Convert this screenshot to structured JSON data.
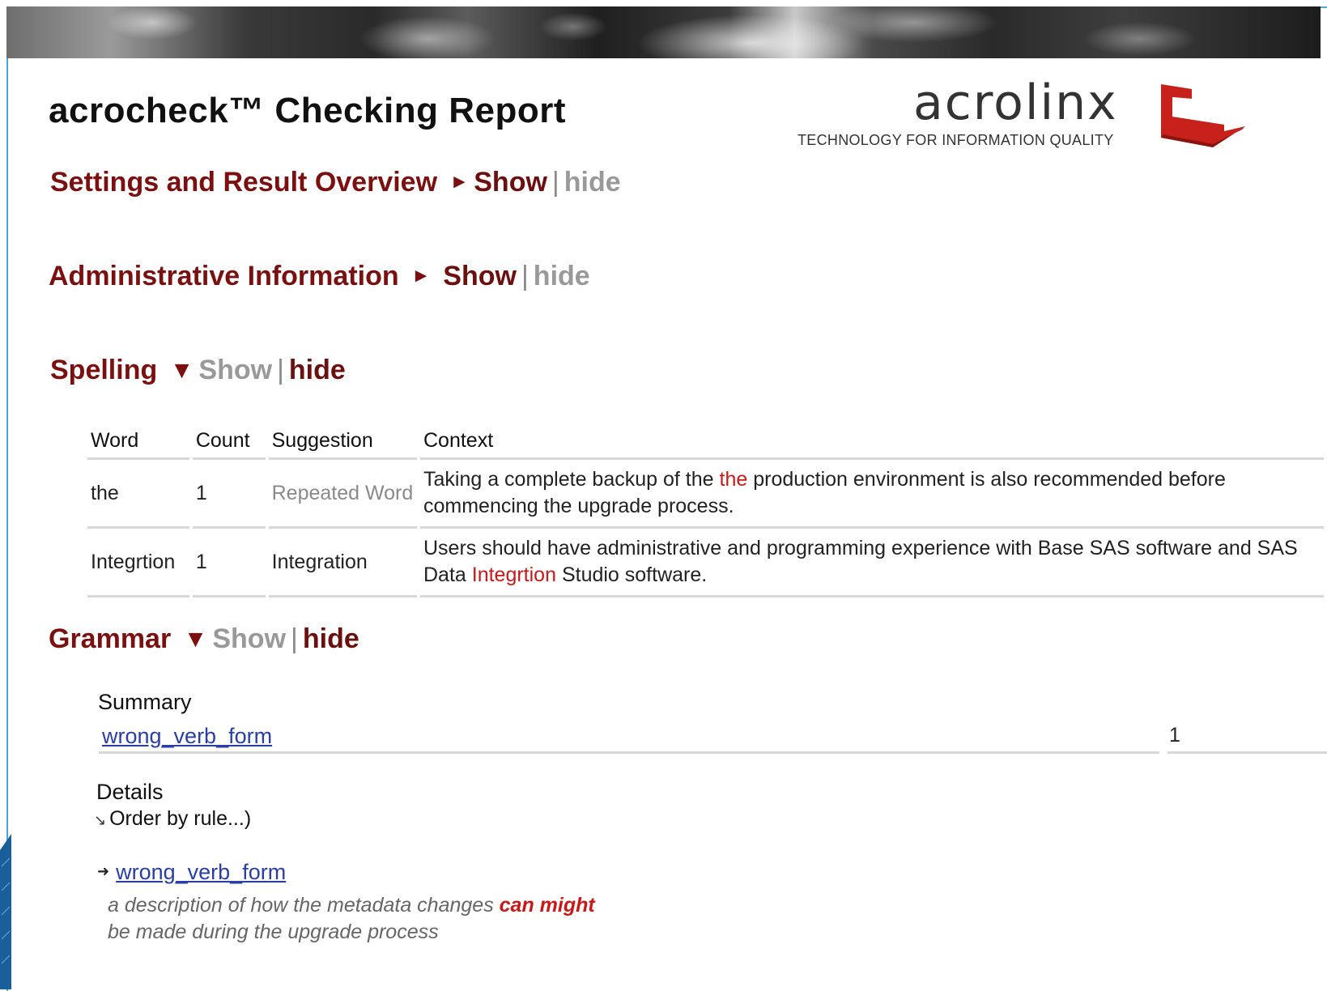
{
  "report": {
    "title": "acrocheck™ Checking Report"
  },
  "logo": {
    "wordmark": "acrolinx",
    "tagline": "TECHNOLOGY FOR INFORMATION QUALITY"
  },
  "sections": {
    "settings": {
      "label": "Settings and Result Overview",
      "show": "Show",
      "hide": "hide"
    },
    "admin": {
      "label": "Administrative Information",
      "show": "Show",
      "hide": "hide"
    },
    "spelling": {
      "label": "Spelling",
      "show": "Show",
      "hide": "hide"
    },
    "grammar": {
      "label": "Grammar",
      "show": "Show",
      "hide": "hide"
    }
  },
  "spelling_table": {
    "headers": {
      "word": "Word",
      "count": "Count",
      "suggestion": "Suggestion",
      "context": "Context"
    },
    "rows": [
      {
        "word": "the",
        "count": "1",
        "suggestion": "Repeated Word",
        "context_before": "Taking a complete backup of the ",
        "context_error": "the",
        "context_after": " production environment is also recommended before commencing the upgrade process."
      },
      {
        "word": "Integrtion",
        "count": "1",
        "suggestion": "Integration",
        "context_before": "Users should have administrative and programming experience with Base SAS software and SAS Data ",
        "context_error": "Integrtion",
        "context_after": " Studio software."
      }
    ]
  },
  "grammar": {
    "summary_label": "Summary",
    "summary_rule": "wrong_verb_form",
    "summary_count": "1",
    "details_label": "Details",
    "order_by": "Order by rule...)",
    "detail_rule": "wrong_verb_form",
    "description_before": "a description of how the metadata changes ",
    "description_error": "can might",
    "description_line2": "be made during the upgrade process"
  },
  "colors": {
    "section_heading": "#7a1010",
    "link_active": "#6b0f0f",
    "link_inactive": "#999999",
    "error_highlight": "#c81818",
    "hyperlink": "#2a3ea8",
    "frame_border": "#4aa6d6",
    "logo_red": "#c8201a"
  },
  "icons": {
    "collapsed_arrow": "right-triangle-icon",
    "expanded_arrow": "down-triangle-icon",
    "order_by": "resize-arrow-icon",
    "detail_expand": "plus-arrow-icon",
    "logo_mark": "acrolinx-logo-icon"
  }
}
